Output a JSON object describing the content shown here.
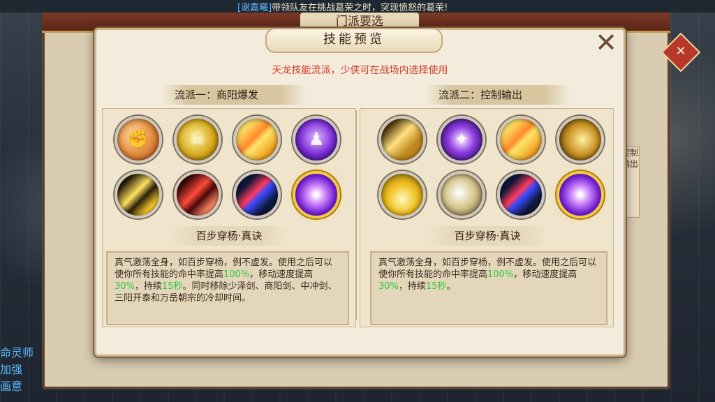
{
  "banner": {
    "name": "[谢嘉曦]",
    "message": "带领队友在挑战葛荣之时，突现愤怒的葛荣!"
  },
  "background_window": {
    "title": "门派要选",
    "side_tabs": [
      "控制",
      "输出"
    ],
    "left_text": [
      "命灵师",
      "加强",
      "画意"
    ],
    "ornament": "✕"
  },
  "dialog": {
    "title": "技能预览",
    "subtitle": "天龙技能流派，少侠可在战场内选择使用",
    "close_symbol": "✕",
    "left": {
      "heading": "流派一：商阳爆发",
      "skill_icons": [
        "fist-icon",
        "golden-skull-icon",
        "golden-orb-icon",
        "purple-figure-icon",
        "golden-streaks-icon",
        "red-streaks-icon",
        "red-sword-icon",
        "purple-burst-icon"
      ],
      "selected_skill": "百步穿杨·真诀",
      "description": {
        "p1": "真气激荡全身，如百步穿杨，例不虚发。使用之后可以使你所有技能的命中率提高",
        "v1": "100%",
        "p2": "，移动速度提高",
        "v2": "30%",
        "p3": "，持续",
        "v3": "15秒",
        "p4": "。同时移除少泽剑、商阳剑、中冲剑、三阳开泰和万岳朝宗的冷却时间。"
      }
    },
    "right": {
      "heading": "流派二：控制输出",
      "skill_icons": [
        "golden-finger-icon",
        "purple-shock-icon",
        "golden-orb-icon",
        "golden-beast-icon",
        "golden-dome-icon",
        "silver-hand-icon",
        "red-sword-icon",
        "purple-burst-icon"
      ],
      "selected_skill": "百步穿杨·真诀",
      "description": {
        "p1": "真气激荡全身，如百步穿杨，例不虚发。使用之后可以使你所有技能的命中率提高",
        "v1": "100%",
        "p2": "，移动速度提高",
        "v2": "30%",
        "p3": "，持续",
        "v3": "15秒",
        "p4": "。"
      }
    }
  },
  "colors": {
    "highlight": "#2ec83a",
    "subtitle": "#d43b2a",
    "selected_ring": "#f2c845"
  }
}
